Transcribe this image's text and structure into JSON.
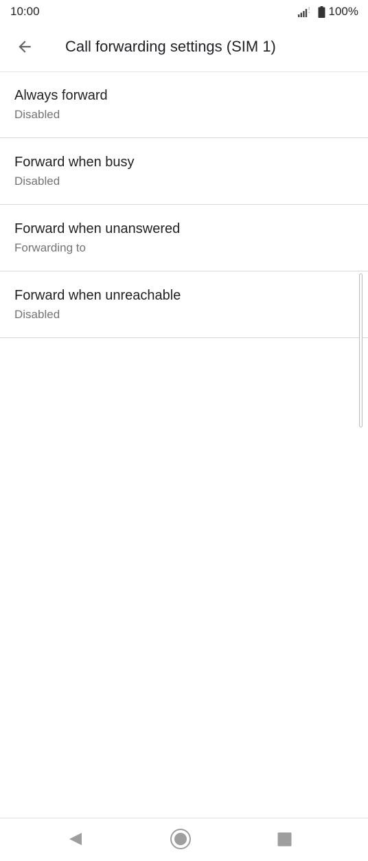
{
  "status_bar": {
    "time": "10:00",
    "battery": "100%",
    "icons": [
      "signal-icon",
      "battery-icon"
    ]
  },
  "app_bar": {
    "title": "Call forwarding settings (SIM 1)",
    "back_icon": "arrow-back-icon"
  },
  "settings": [
    {
      "title": "Always forward",
      "summary": "Disabled"
    },
    {
      "title": "Forward when busy",
      "summary": "Disabled"
    },
    {
      "title": "Forward when unanswered",
      "summary": "Forwarding to"
    },
    {
      "title": "Forward when unreachable",
      "summary": "Disabled"
    }
  ],
  "nav_bar": {
    "icons": [
      "nav-back-icon",
      "nav-home-icon",
      "nav-recents-icon"
    ]
  },
  "colors": {
    "background": "#ffffff",
    "title_text": "#212121",
    "summary_text": "#737373",
    "divider": "#d8d8d8",
    "nav_icon": "#9e9e9e"
  }
}
